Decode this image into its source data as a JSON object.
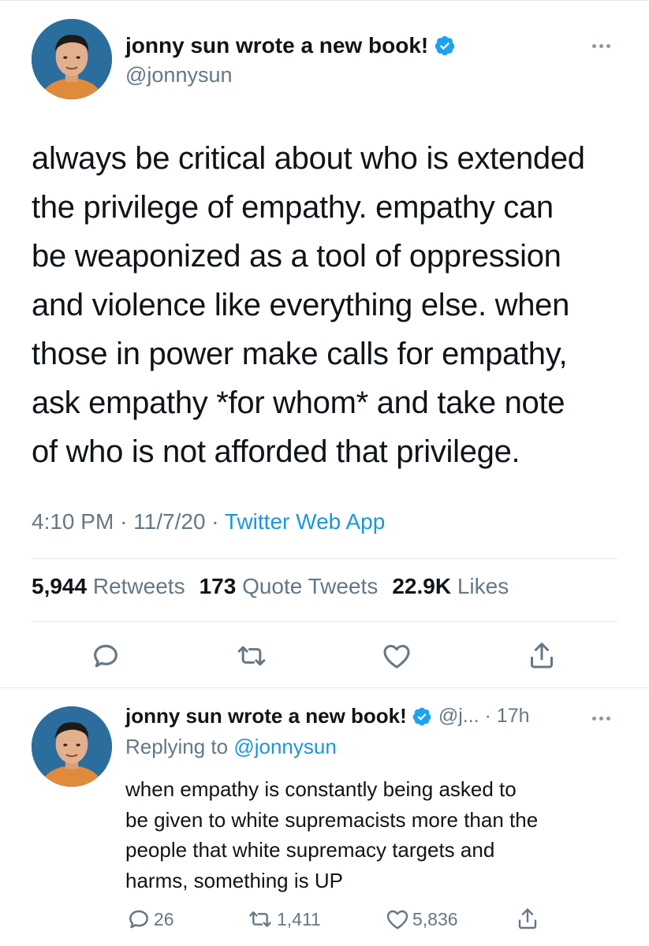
{
  "tweet": {
    "author_name": "jonny sun wrote a new book!",
    "handle": "@jonnysun",
    "lines": [
      "always be critical about who is extended",
      "the privilege of empathy. empathy can",
      "be weaponized as a tool of oppression",
      "and violence like everything else. when",
      "those in power make calls for empathy,",
      "ask empathy *for whom* and take note",
      "of who is not afforded that privilege."
    ],
    "time": "4:10 PM",
    "date": "11/7/20",
    "dot": "·",
    "source": "Twitter Web App",
    "retweets_count": "5,944",
    "retweets_label": "Retweets",
    "quotes_count": "173",
    "quotes_label": "Quote Tweets",
    "likes_count": "22.9K",
    "likes_label": "Likes"
  },
  "reply": {
    "author_name": "jonny sun wrote a new book!",
    "handle_time": "@j... · 17h",
    "replying_prefix": "Replying to",
    "replying_handle": "@jonnysun",
    "lines": [
      "when empathy is constantly being asked to",
      "be given to white supremacists more than the",
      "people that white supremacy targets and",
      "harms, something is UP"
    ],
    "reply_count": "26",
    "retweet_count": "1,411",
    "like_count": "5,836"
  },
  "colors": {
    "text": "#0f1419",
    "secondary": "#657786",
    "link": "#1b95e0",
    "verified": "#1da1f2",
    "divider": "#e1e8ed"
  },
  "icons": [
    "verified-badge-icon",
    "more-icon",
    "reply-icon",
    "retweet-icon",
    "like-icon",
    "share-icon"
  ]
}
